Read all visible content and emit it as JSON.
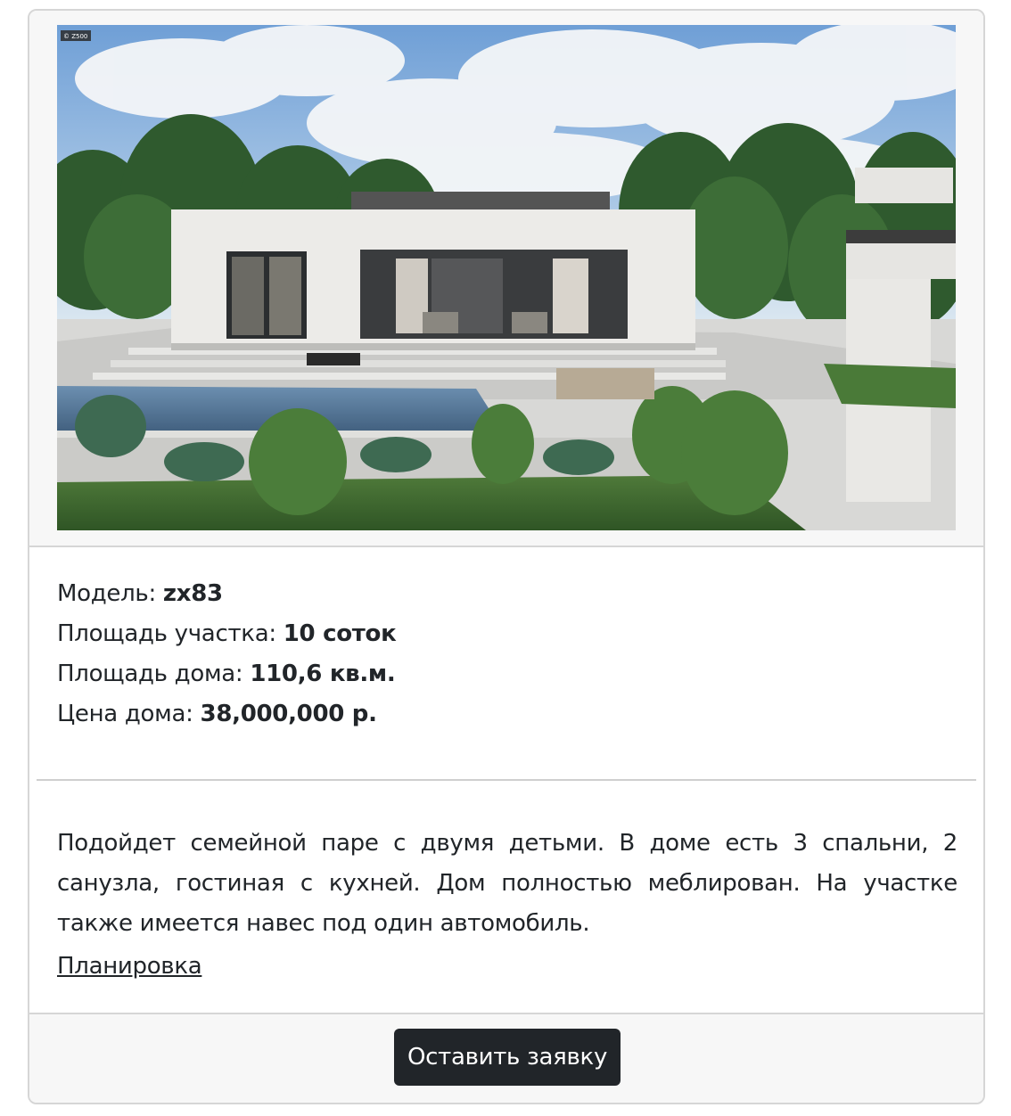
{
  "image": {
    "watermark": "© Z500"
  },
  "specs": [
    {
      "label": "Модель: ",
      "value": "zx83"
    },
    {
      "label": "Площадь участка: ",
      "value": "10 соток"
    },
    {
      "label": "Площадь дома: ",
      "value": "110,6 кв.м."
    },
    {
      "label": "Цена дома: ",
      "value": "38,000,000 р."
    }
  ],
  "description": "Подойдет семейной паре с двумя детьми. В доме есть 3 спальни, 2 санузла, гостиная с кухней. Дом полностью меблирован. На участке также имеется навес под один автомобиль.",
  "plan_link": "Планировка",
  "button_label": "Оставить заявку",
  "colors": {
    "button_bg": "#212529",
    "footer_bg": "#f7f7f7",
    "border": "#d6d6d6"
  }
}
